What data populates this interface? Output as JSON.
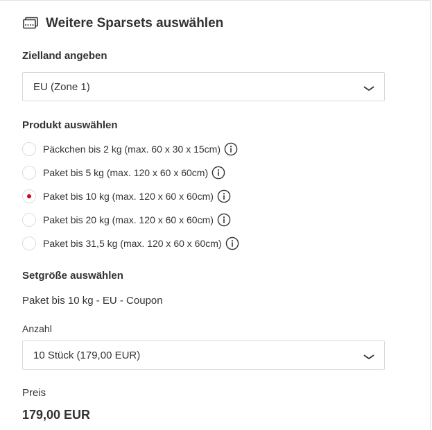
{
  "header": {
    "title": "Weitere Sparsets auswählen",
    "icon": "coupon-stack-icon"
  },
  "destination": {
    "label": "Zielland angeben",
    "selected": "EU (Zone 1)"
  },
  "product": {
    "label": "Produkt auswählen",
    "options": [
      {
        "label": "Päckchen bis 2 kg (max. 60 x 30 x 15cm)",
        "checked": false
      },
      {
        "label": "Paket bis 5 kg (max. 120 x 60 x 60cm)",
        "checked": false
      },
      {
        "label": "Paket bis 10 kg (max. 120 x 60 x 60cm)",
        "checked": true
      },
      {
        "label": "Paket bis 20 kg (max. 120 x 60 x 60cm)",
        "checked": false
      },
      {
        "label": "Paket bis 31,5 kg (max. 120 x 60 x 60cm)",
        "checked": false
      }
    ]
  },
  "setsize": {
    "label": "Setgröße auswählen",
    "product_name": "Paket bis 10 kg - EU - Coupon",
    "quantity_label": "Anzahl",
    "quantity_selected": "10 Stück (179,00 EUR)"
  },
  "price": {
    "label": "Preis",
    "value": "179,00 EUR"
  },
  "colors": {
    "accent": "#d40511",
    "text": "#323232",
    "border": "#d9d9d9"
  }
}
